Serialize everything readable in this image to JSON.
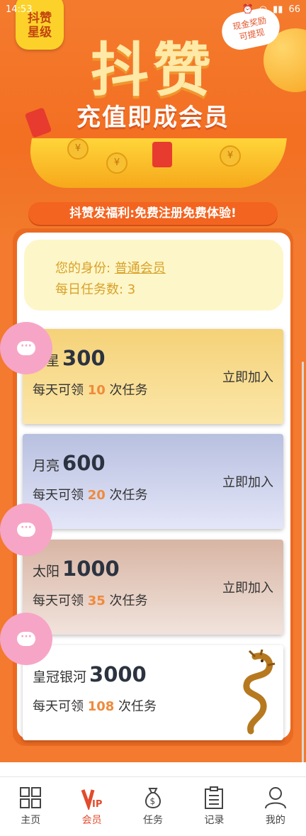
{
  "status_bar": {
    "time": "14:53",
    "battery": "66"
  },
  "banner": {
    "badge_line1": "抖赞",
    "badge_line2": "星级",
    "big_title": "抖赞",
    "cash_line1": "现金奖励",
    "cash_line2": "可提现",
    "subtitle": "充值即成会员",
    "welfare": "抖赞发福利:免费注册免费体验!"
  },
  "identity": {
    "label": "您的身份:",
    "value": "普通会员",
    "tasks": "每日任务数: 3"
  },
  "tiers": [
    {
      "name": "星星",
      "price": "300",
      "desc_pre": "每天可领",
      "count": "10",
      "desc_post": "次任务",
      "join": "立即加入",
      "bg_top": "#f5d278",
      "bg_bottom": "#fbe6a9"
    },
    {
      "name": "月亮",
      "price": "600",
      "desc_pre": "每天可领",
      "count": "20",
      "desc_post": "次任务",
      "join": "立即加入",
      "bg_top": "#b8c0e0",
      "bg_bottom": "#e4e6f8"
    },
    {
      "name": "太阳",
      "price": "1000",
      "desc_pre": "每天可领",
      "count": "35",
      "desc_post": "次任务",
      "join": "立即加入",
      "bg_top": "#d8b5a4",
      "bg_bottom": "#f1e3dc"
    },
    {
      "name": "皇冠银河",
      "price": "3000",
      "desc_pre": "每天可领",
      "count": "108",
      "desc_post": "次任务",
      "join": "",
      "bg_top": "#ffffff",
      "bg_bottom": "#ffffff"
    }
  ],
  "chat_icon": "chat-bubble-icon",
  "tabs": [
    {
      "label": "主页",
      "icon": "grid-icon"
    },
    {
      "label": "会员",
      "icon": "vip-icon"
    },
    {
      "label": "任务",
      "icon": "money-bag-icon"
    },
    {
      "label": "记录",
      "icon": "clipboard-icon"
    },
    {
      "label": "我的",
      "icon": "user-icon"
    }
  ],
  "colors": {
    "brand_orange": "#f37a2e",
    "active_tab": "#e24b2d",
    "highlight": "#f08a3a"
  }
}
